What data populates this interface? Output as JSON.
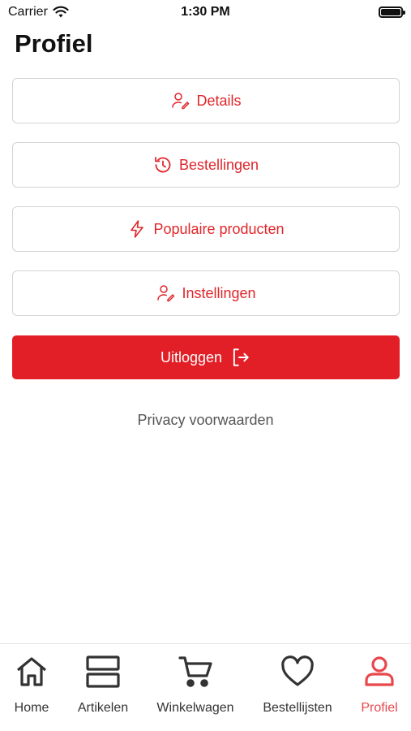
{
  "status": {
    "carrier": "Carrier",
    "time": "1:30 PM"
  },
  "page": {
    "title": "Profiel"
  },
  "menu": {
    "details": "Details",
    "orders": "Bestellingen",
    "popular": "Populaire producten",
    "settings": "Instellingen"
  },
  "logout": {
    "label": "Uitloggen"
  },
  "privacy": {
    "label": "Privacy voorwaarden"
  },
  "tabs": [
    {
      "label": "Home",
      "icon": "home-icon"
    },
    {
      "label": "Artikelen",
      "icon": "articles-icon"
    },
    {
      "label": "Winkelwagen",
      "icon": "cart-icon"
    },
    {
      "label": "Bestellijsten",
      "icon": "heart-icon"
    },
    {
      "label": "Profiel",
      "icon": "user-icon",
      "active": true
    }
  ],
  "colors": {
    "accent": "#e21f26",
    "active_tab": "#e8474c",
    "border": "#d4d4d4"
  }
}
